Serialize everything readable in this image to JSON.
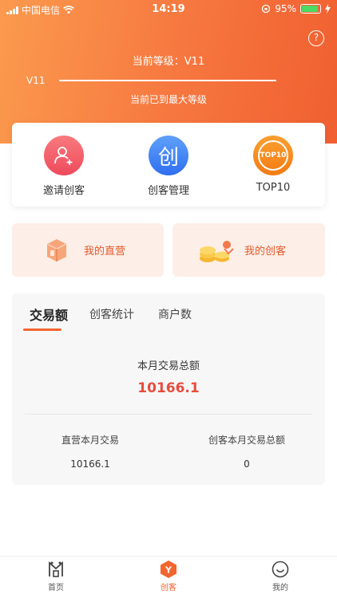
{
  "status": {
    "carrier": "中国电信",
    "time": "14:19",
    "battery": "95%"
  },
  "header": {
    "level_title": "当前等级：V11",
    "level_tag": "V11",
    "level_progress": 1.0,
    "level_msg": "当前已到最大等级",
    "help_glyph": "?"
  },
  "quick": [
    {
      "label": "邀请创客",
      "icon": "invite-user-icon"
    },
    {
      "label": "创客管理",
      "icon": "create-icon",
      "glyph": "创"
    },
    {
      "label": "TOP10",
      "icon": "top10-icon",
      "glyph": "TOP10"
    }
  ],
  "promos": [
    {
      "label": "我的直营",
      "icon": "shop-box-icon"
    },
    {
      "label": "我的创客",
      "icon": "coins-icon"
    }
  ],
  "stats": {
    "tabs": [
      "交易额",
      "创客统计",
      "商户数"
    ],
    "active_tab": 0,
    "month_label": "本月交易总额",
    "month_value": "10166.1",
    "direct_label": "直营本月交易",
    "direct_value": "10166.1",
    "maker_label": "创客本月交易总额",
    "maker_value": "0"
  },
  "tabbar": [
    {
      "label": "首页",
      "icon": "home-icon"
    },
    {
      "label": "创客",
      "icon": "maker-icon",
      "glyph": "Y"
    },
    {
      "label": "我的",
      "icon": "profile-icon"
    }
  ],
  "colors": {
    "accent": "#f2652f",
    "header_start": "#fb9a4e",
    "header_end": "#f05f30",
    "value_red": "#e84b3c"
  }
}
